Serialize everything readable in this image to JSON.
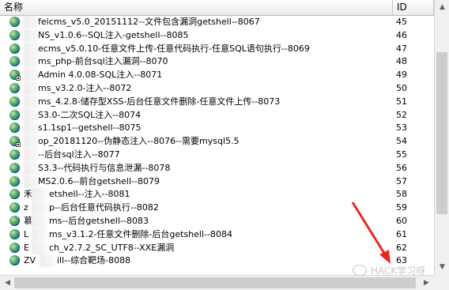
{
  "header": {
    "col_name": "名称",
    "col_id": "ID"
  },
  "rows": [
    {
      "name": "feicms_v5.0_20151112--文件包含漏洞getshell--8067",
      "id": "45",
      "badge": false
    },
    {
      "name": "NS_v1.0.6--SQL注入-getshell--8085",
      "id": "46",
      "badge": false
    },
    {
      "name": "ecms_v5.0.10-任意文件上传-任意代码执行-任意SQL语句执行--8069",
      "id": "47",
      "badge": false
    },
    {
      "name": "ms_php-前台sql注入漏洞--8070",
      "id": "48",
      "badge": false
    },
    {
      "name": "Admin 4.0.08-SQL注入--8071",
      "id": "49",
      "badge": true
    },
    {
      "name": "ms_v3.2.0-注入--8072",
      "id": "50",
      "badge": false
    },
    {
      "name": "ms_4.2.8-储存型XSS-后台任意文件删除-任意文件上传--8073",
      "id": "51",
      "badge": false
    },
    {
      "name": "S3.0-二次SQL注入--8074",
      "id": "52",
      "badge": false
    },
    {
      "name": "s1.1sp1--getshell--8075",
      "id": "53",
      "badge": false
    },
    {
      "name": "op_20181120--伪静态注入--8076--需要mysql5.5",
      "id": "54",
      "badge": true
    },
    {
      "name": "--后台sql注入--8077",
      "id": "55",
      "badge": false
    },
    {
      "name": "S3.3--代码执行与信息泄漏--8078",
      "id": "56",
      "badge": false
    },
    {
      "name": "MS2.0.6--前台getshell--8079",
      "id": "57",
      "badge": false
    },
    {
      "name": "etshell--注入--8081",
      "id": "58",
      "badge": false
    },
    {
      "name": "p--后台任意代码执行--8082",
      "id": "59",
      "badge": false
    },
    {
      "name": "ms--后台getshell--8083",
      "id": "60",
      "badge": false
    },
    {
      "name": "ms_v3.1.2-任意文件删除-后台getshell--8084",
      "id": "61",
      "badge": false
    },
    {
      "name": "ch_v2.7.2_SC_UTF8--XXE漏洞",
      "id": "62",
      "badge": false
    },
    {
      "name": "ill--综合靶场-8088",
      "id": "63",
      "badge": false
    }
  ],
  "row_prefixes": [
    "",
    "",
    "",
    "",
    "",
    "",
    "",
    "",
    "",
    "",
    "",
    "",
    "",
    "禾",
    "z",
    "慕",
    "L",
    "E",
    "ZV"
  ],
  "watermark": {
    "text": "HACK学习呀"
  },
  "colors": {
    "arrow": "#e8281e",
    "header_bg": "#f3f3f3",
    "scroll_bg": "#f0f0f0"
  },
  "icons": {
    "row": "globe-icon",
    "badge": "overlay-badge-icon",
    "arrow": "red-arrow-annotation"
  }
}
